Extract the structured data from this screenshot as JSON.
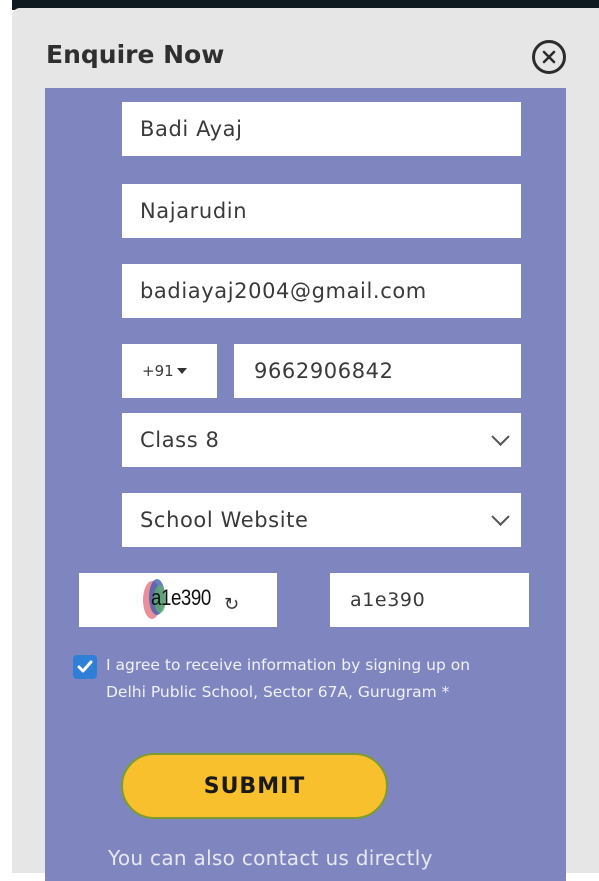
{
  "modal": {
    "title": "Enquire Now",
    "close_icon": "circle-x-icon"
  },
  "form": {
    "first_name": "Badi Ayaj",
    "last_name": "Najarudin",
    "email": "badiayaj2004@gmail.com",
    "country_code": "+91",
    "phone": "9662906842",
    "class_select": "Class 8",
    "source_select": "School Website",
    "captcha_image_text": "a1e390",
    "captcha_input": "a1e390",
    "consent_checked": true,
    "consent_text": "I agree to receive information by signing up on Delhi Public School, Sector 67A, Gurugram *",
    "submit_label": "SUBMIT",
    "contact_text": "You can also contact us directly"
  },
  "colors": {
    "panel": "#7f86bf",
    "modal_bg": "#e6e6e6",
    "submit": "#f8c02c",
    "checkbox": "#2f7fd8"
  }
}
